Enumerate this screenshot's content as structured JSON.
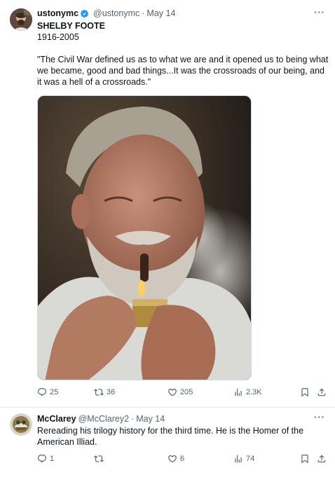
{
  "tweets": [
    {
      "author": {
        "display_name": "ustonymc",
        "handle": "@ustonymc",
        "verified": true
      },
      "date": "May 14",
      "separator": "·",
      "more_label": "···",
      "text": {
        "name": "SHELBY FOOTE",
        "years": "1916-2005",
        "quote": "\"The Civil War defined us as to what we are and it opened us to being what we became, good and bad things...It was the crossroads of our being, and it was a hell of a crossroads.\""
      },
      "media": {
        "type": "photo"
      },
      "stats": {
        "replies": "25",
        "retweets": "36",
        "likes": "205",
        "views": "2.3K"
      }
    },
    {
      "author": {
        "display_name": "McClarey",
        "handle": "@McClarey2",
        "verified": false
      },
      "date": "May 14",
      "separator": "·",
      "more_label": "···",
      "text": "Rereading his trilogy history for the third time.  He is the Homer of the American Illiad.",
      "stats": {
        "replies": "1",
        "retweets": "",
        "likes": "6",
        "views": "74"
      }
    }
  ],
  "colors": {
    "text": "#0f1419",
    "secondary": "#536471",
    "verified": "#1d9bf0",
    "border": "#e6ecf0"
  },
  "icons": [
    "reply-icon",
    "retweet-icon",
    "like-icon",
    "views-icon",
    "bookmark-icon",
    "share-icon",
    "verified-badge-icon",
    "more-icon"
  ]
}
